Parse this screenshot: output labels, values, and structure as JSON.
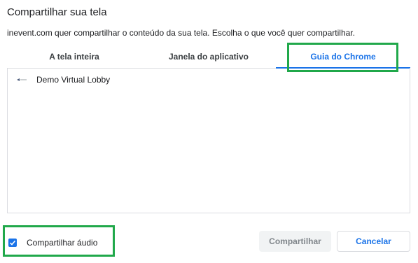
{
  "dialog": {
    "title": "Compartilhar sua tela",
    "subtitle": "inevent.com quer compartilhar o conteúdo da sua tela. Escolha o que você quer compartilhar."
  },
  "tabs": [
    {
      "label": "A tela inteira",
      "selected": false
    },
    {
      "label": "Janela do aplicativo",
      "selected": false
    },
    {
      "label": "Guia do Chrome",
      "selected": true
    }
  ],
  "list": {
    "items": [
      {
        "label": "Demo Virtual Lobby",
        "icon": "tab-favicon-icon"
      }
    ]
  },
  "audio": {
    "label": "Compartilhar áudio",
    "checked": true
  },
  "buttons": {
    "share_label": "Compartilhar",
    "cancel_label": "Cancelar"
  },
  "colors": {
    "accent": "#1a73e8",
    "highlight": "#20a84a",
    "disabled_bg": "#f1f3f4",
    "disabled_text": "#80868b"
  }
}
